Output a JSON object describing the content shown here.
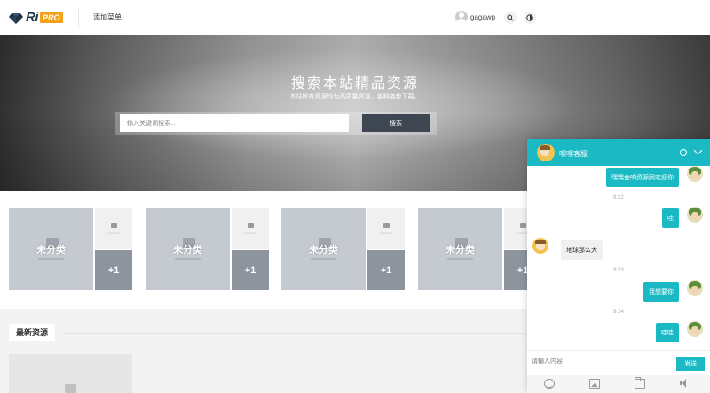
{
  "header": {
    "logo_text": "Ri",
    "logo_badge": "PRO",
    "nav_add_menu": "添加菜单",
    "username": "gagawp",
    "search_icon": "search-icon",
    "theme_icon": "theme-toggle-icon"
  },
  "hero": {
    "title": "搜索本站精品资源",
    "subtitle": "本站所有资源均为高质量资源，各种姿势下载。",
    "search_placeholder": "输入关键词搜索...",
    "search_button": "搜索"
  },
  "categories": [
    {
      "label": "未分类",
      "placeholder_text": "thumbnail",
      "count": "+1"
    },
    {
      "label": "未分类",
      "placeholder_text": "thumbnail",
      "count": "+1"
    },
    {
      "label": "未分类",
      "placeholder_text": "thumbnail",
      "count": "+1"
    },
    {
      "label": "未分类",
      "placeholder_text": "thumbnail",
      "count": "+1"
    }
  ],
  "latest": {
    "tab_label": "最新资源"
  },
  "chat": {
    "title": "嘿嘿客服",
    "messages": [
      {
        "dir": "out",
        "text": "嘿嘿会响资源网欢迎你"
      },
      {
        "type": "time",
        "text": "8:22"
      },
      {
        "dir": "out",
        "text": "哇"
      },
      {
        "dir": "in",
        "text": "地球那么大"
      },
      {
        "type": "time",
        "text": "8:23"
      },
      {
        "dir": "out",
        "text": "我想要你"
      },
      {
        "type": "time",
        "text": "8:24"
      },
      {
        "dir": "out",
        "text": "哇哇"
      }
    ],
    "input_placeholder": "请输入内容",
    "send_button": "发送",
    "accent": "#1ab9c4"
  }
}
